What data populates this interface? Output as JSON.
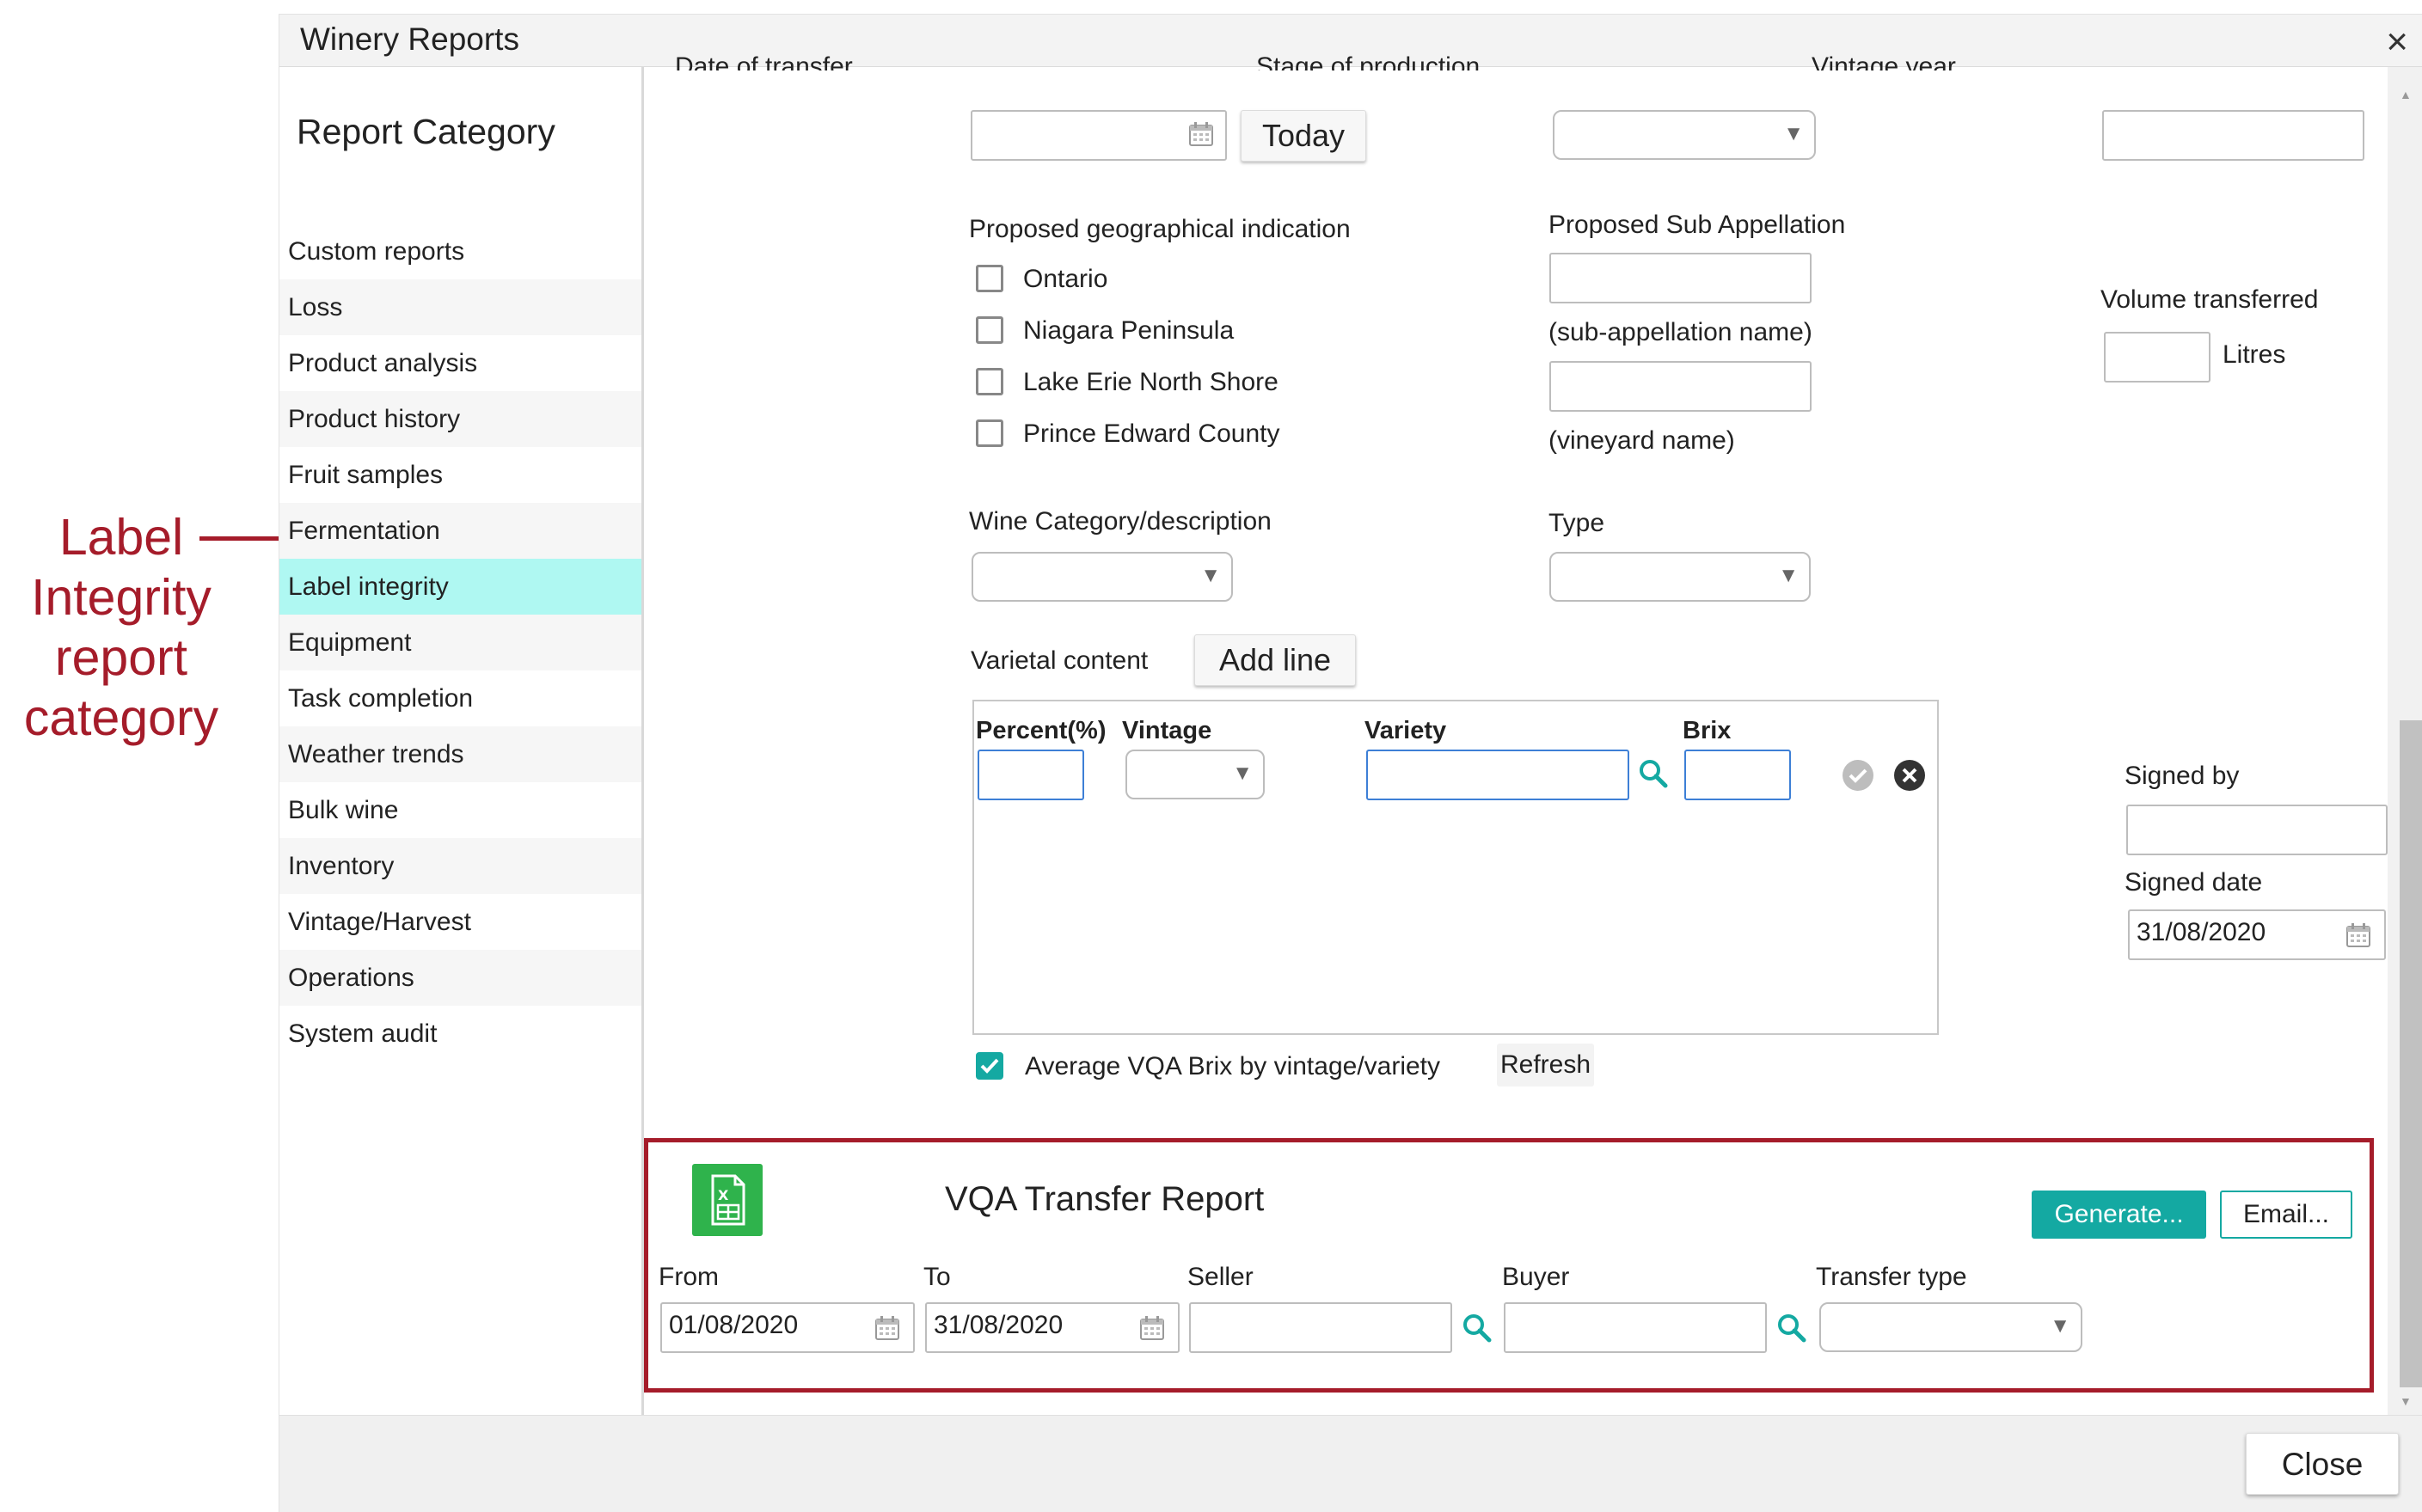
{
  "annotation": {
    "line1": "Label",
    "line2": "Integrity",
    "line3": "report",
    "line4": "category"
  },
  "window": {
    "title": "Winery Reports",
    "close_glyph": "×"
  },
  "sidebar": {
    "title": "Report Category",
    "items": [
      {
        "label": "Custom reports"
      },
      {
        "label": "Loss"
      },
      {
        "label": "Product analysis"
      },
      {
        "label": "Product history"
      },
      {
        "label": "Fruit samples"
      },
      {
        "label": "Fermentation"
      },
      {
        "label": "Label integrity"
      },
      {
        "label": "Equipment"
      },
      {
        "label": "Task completion"
      },
      {
        "label": "Weather trends"
      },
      {
        "label": "Bulk wine"
      },
      {
        "label": "Inventory"
      },
      {
        "label": "Vintage/Harvest"
      },
      {
        "label": "Operations"
      },
      {
        "label": "System audit"
      }
    ],
    "active_color": "#aff8f2"
  },
  "form": {
    "date_of_transfer_label": "Date of transfer",
    "today_label": "Today",
    "stage_label": "Stage of production",
    "vintage_year_label": "Vintage year",
    "geo_label": "Proposed geographical indication",
    "geo_options": [
      "Ontario",
      "Niagara Peninsula",
      "Lake Erie North Shore",
      "Prince Edward County"
    ],
    "sub_appellation_label": "Proposed Sub Appellation",
    "sub_appellation_name": "(sub-appellation name)",
    "vineyard_name": "(vineyard name)",
    "volume_label": "Volume transferred",
    "litres_label": "Litres",
    "wine_category_label": "Wine Category/description",
    "type_label": "Type",
    "varietal_label": "Varietal content",
    "add_line_label": "Add line",
    "grid_headers": {
      "percent": "Percent(%)",
      "vintage": "Vintage",
      "variety": "Variety",
      "brix": "Brix"
    },
    "signed_by_label": "Signed by",
    "signed_date_label": "Signed date",
    "signed_date_value": "31/08/2020",
    "avg_label": "Average VQA Brix by vintage/variety",
    "refresh_label": "Refresh"
  },
  "vqa": {
    "title": "VQA Transfer Report",
    "generate_label": "Generate...",
    "email_label": "Email...",
    "from_label": "From",
    "from_value": "01/08/2020",
    "to_label": "To",
    "to_value": "31/08/2020",
    "seller_label": "Seller",
    "buyer_label": "Buyer",
    "transfer_type_label": "Transfer type",
    "accent_color": "#14a9a2",
    "border_color": "#a51c2a"
  },
  "footer": {
    "close_label": "Close"
  }
}
